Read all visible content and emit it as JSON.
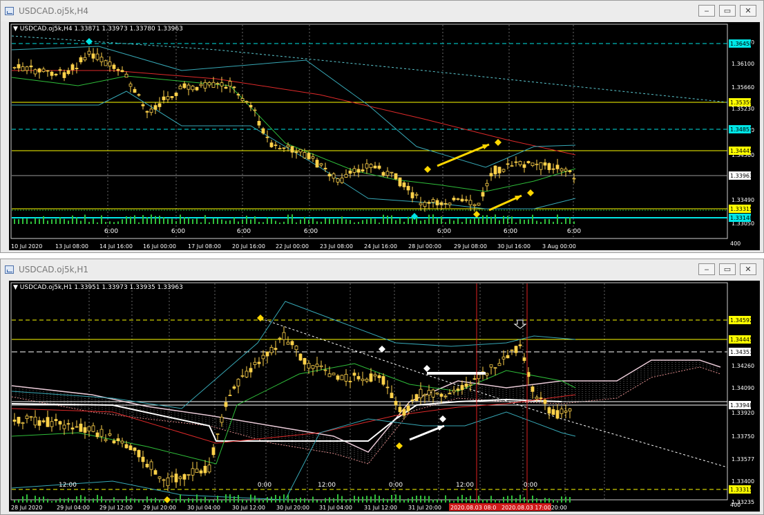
{
  "window1": {
    "title": "USDCAD.oj5k,H4",
    "info": "▼ USDCAD.oj5k,H4  1.33871 1.33973 1.33780 1.33963",
    "price_scale": [
      "1.36530",
      "1.36100",
      "1.35660",
      "1.35230",
      "1.34790",
      "1.34360",
      "1.33490",
      "1.33050"
    ],
    "tags": [
      {
        "label": "1.36458",
        "color": "#00e5e5"
      },
      {
        "label": "1.35359",
        "color": "#ffff00"
      },
      {
        "label": "1.34851",
        "color": "#00e5e5"
      },
      {
        "label": "1.34445",
        "color": "#ffff00"
      },
      {
        "label": "1.33963",
        "color": "#ffffff"
      },
      {
        "label": "1.33315",
        "color": "#ffff00"
      },
      {
        "label": "1.33148",
        "color": "#00e5e5"
      }
    ],
    "inner_times": [
      "6:00",
      "6:00",
      "6:00",
      "6:00",
      "6:00",
      "6:00",
      "6:00"
    ],
    "date_axis": [
      "10 Jul 2020",
      "13 Jul 08:00",
      "14 Jul 16:00",
      "16 Jul 00:00",
      "17 Jul 08:00",
      "20 Jul 16:00",
      "22 Jul 00:00",
      "23 Jul 08:00",
      "24 Jul 16:00",
      "28 Jul 00:00",
      "29 Jul 08:00",
      "30 Jul 16:00",
      "3 Aug 00:00"
    ],
    "axis_end": "400"
  },
  "window2": {
    "title": "USDCAD.oj5k,H1",
    "info": "▼ USDCAD.oj5k,H1  1.33951 1.33973 1.33935 1.33963",
    "price_scale": [
      "1.34260",
      "1.34090",
      "1.33920",
      "1.33750",
      "1.33577",
      "1.33400",
      "1.33235"
    ],
    "tags": [
      {
        "label": "1.34592",
        "color": "#ffff00"
      },
      {
        "label": "1.34445",
        "color": "#ffff00"
      },
      {
        "label": "1.34353",
        "color": "#ffffff"
      },
      {
        "label": "1.33948",
        "color": "#ffffff"
      },
      {
        "label": "1.33315",
        "color": "#ffff00"
      }
    ],
    "inner_times": [
      "12:00",
      "0:00",
      "12:00",
      "0:00",
      "12:00",
      "0:00"
    ],
    "date_axis": [
      "28 Jul 2020",
      "29 Jul 04:00",
      "29 Jul 12:00",
      "29 Jul 20:00",
      "30 Jul 04:00",
      "30 Jul 12:00",
      "30 Jul 20:00",
      "31 Jul 04:00",
      "31 Jul 12:00",
      "31 Jul 20:00",
      "ug 20:00"
    ],
    "vline_labels": [
      "2020.08.03 08:0",
      "2020.08.03 17:00"
    ],
    "axis_end": "400"
  },
  "colors": {
    "candle": "#ffd24a",
    "bg": "#000000",
    "grid": "#6a6a6a",
    "ma_red": "#e02a2a",
    "ma_green": "#2fbf3a",
    "band": "#37a9b7"
  }
}
